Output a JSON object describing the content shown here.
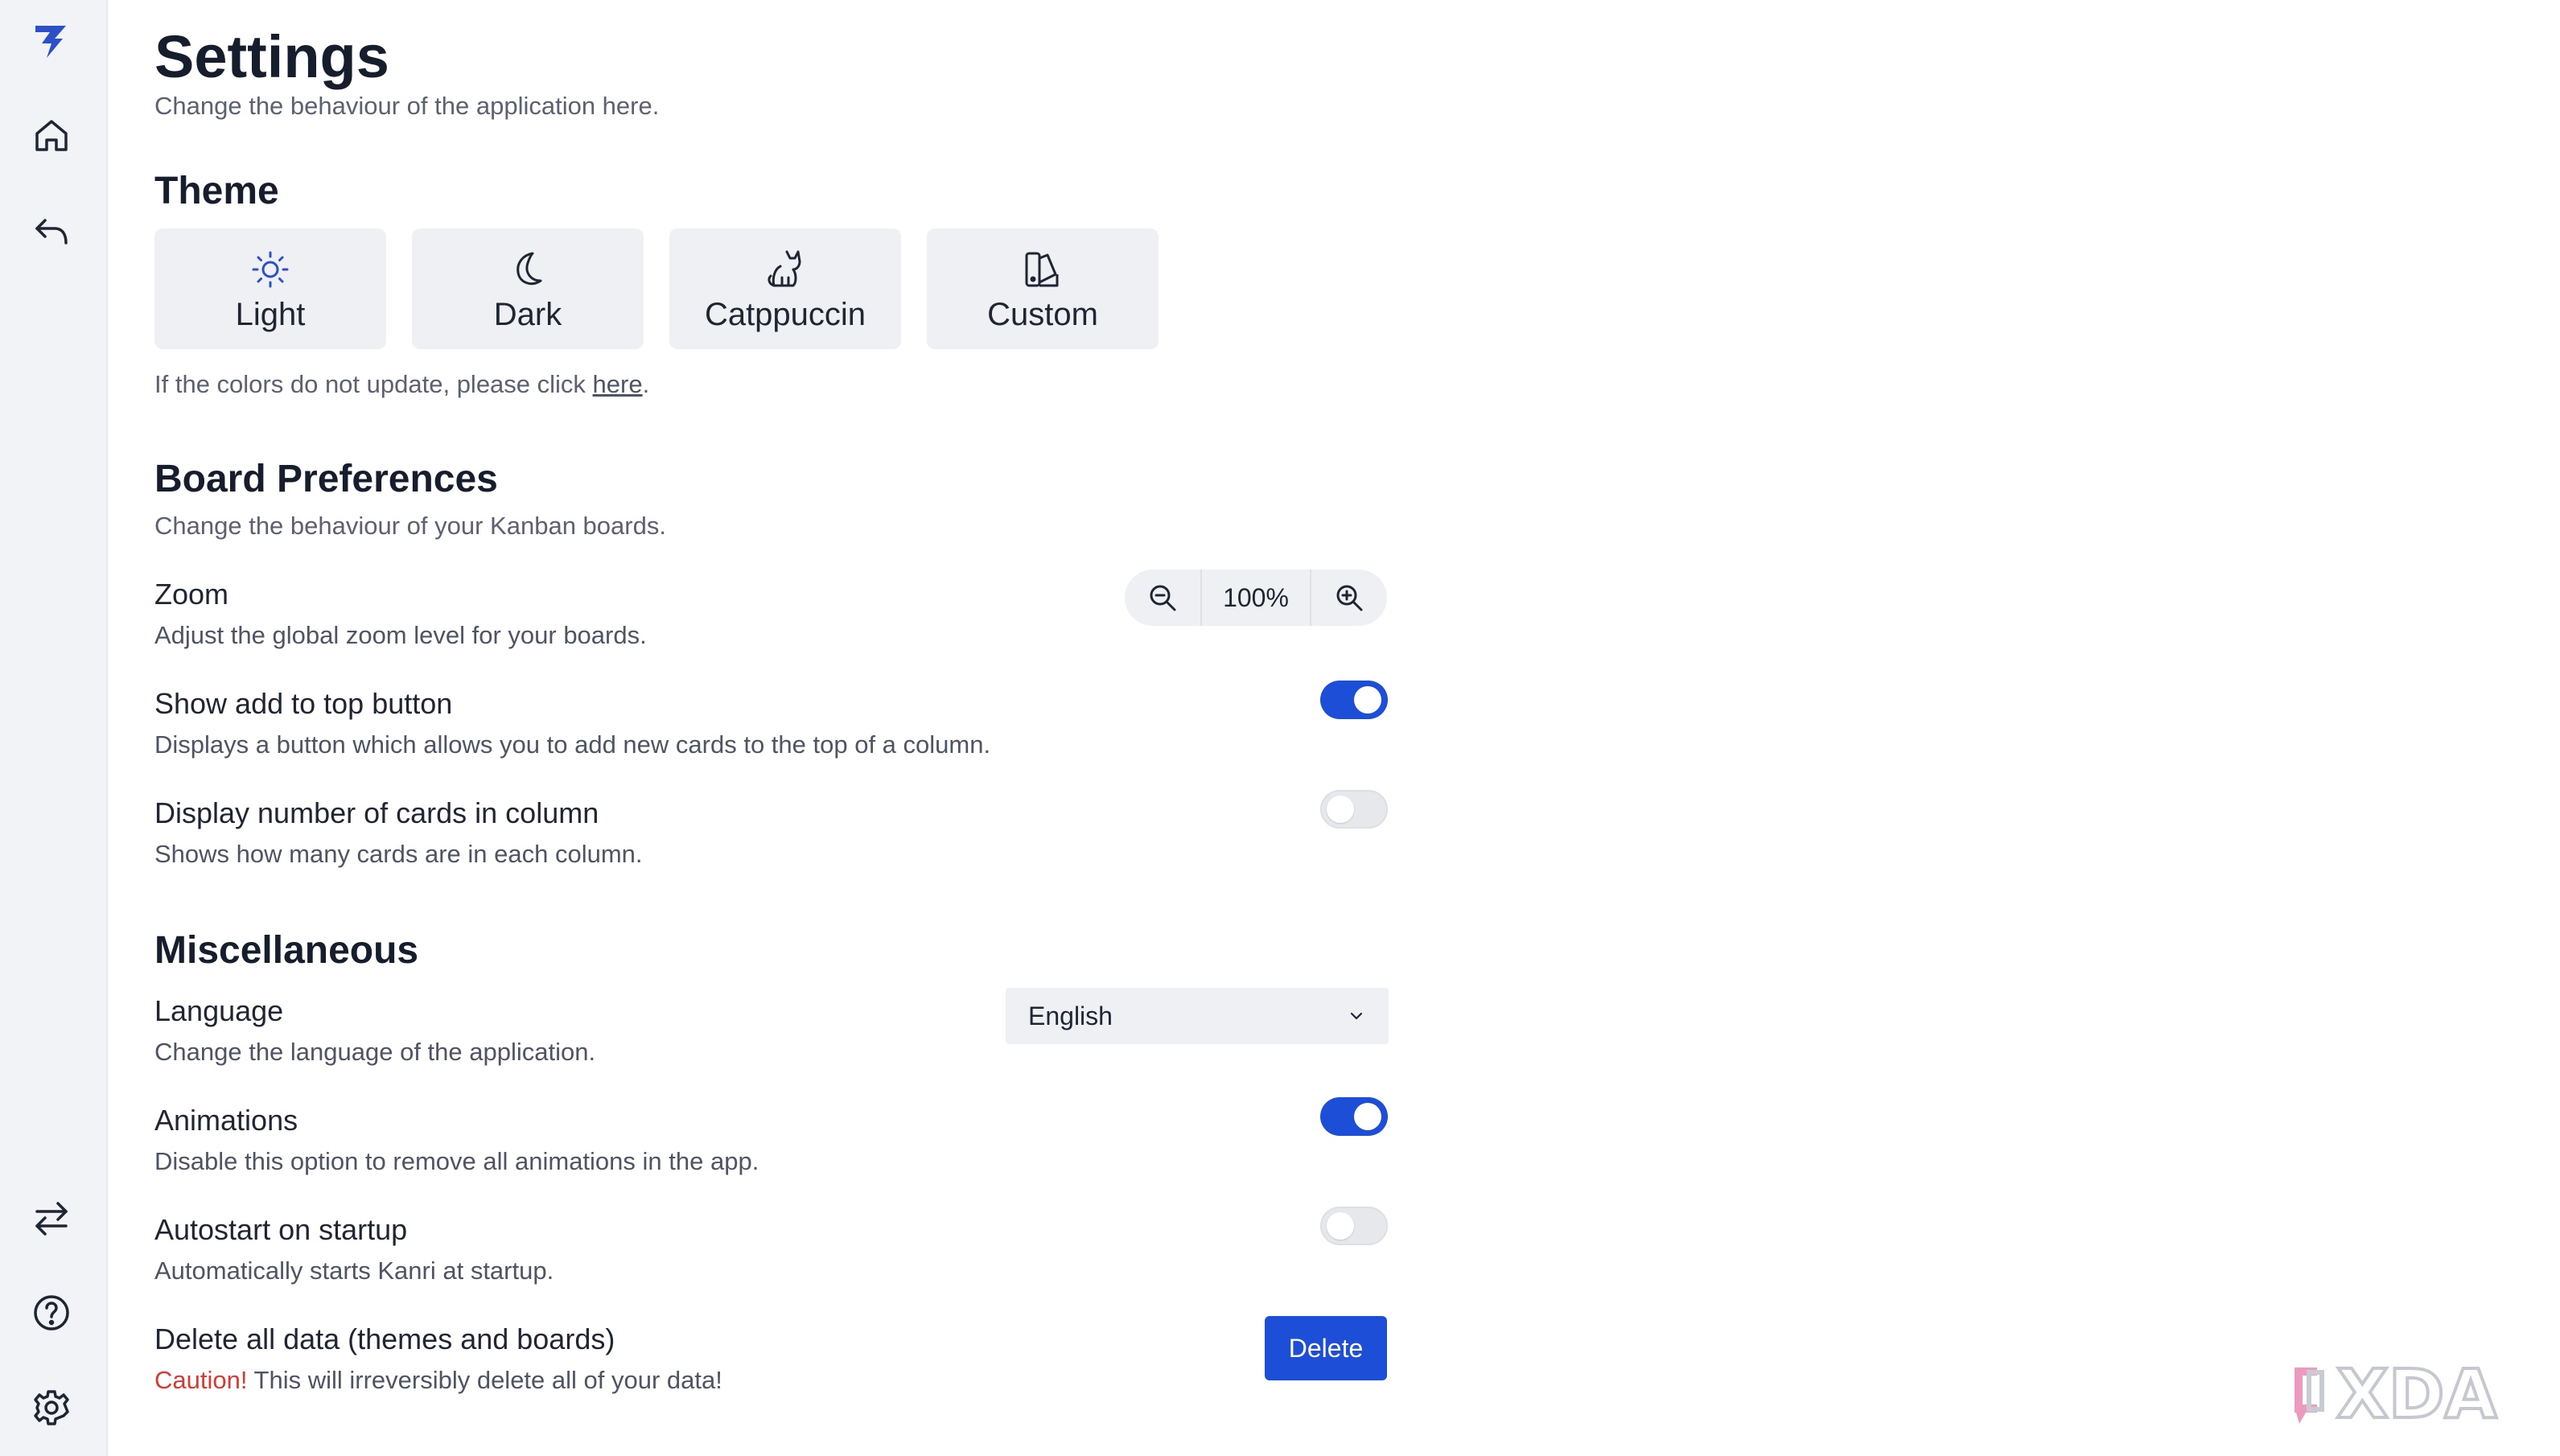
{
  "sidebar": {
    "icons": [
      "logo-icon",
      "home-icon",
      "back-icon",
      "swap-icon",
      "help-icon",
      "settings-icon"
    ]
  },
  "header": {
    "title": "Settings",
    "subtitle": "Change the behaviour of the application here."
  },
  "theme": {
    "title": "Theme",
    "options": [
      {
        "label": "Light",
        "icon": "sun-icon",
        "active": true
      },
      {
        "label": "Dark",
        "icon": "moon-icon"
      },
      {
        "label": "Catppuccin",
        "icon": "cat-icon"
      },
      {
        "label": "Custom",
        "icon": "palette-icon"
      }
    ],
    "note_prefix": "If the colors do not update, please click ",
    "note_link": "here",
    "note_suffix": "."
  },
  "board": {
    "title": "Board Preferences",
    "subtitle": "Change the behaviour of your Kanban boards.",
    "zoom": {
      "label": "Zoom",
      "desc": "Adjust the global zoom level for your boards.",
      "value": "100%"
    },
    "add_top": {
      "label": "Show add to top button",
      "desc": "Displays a button which allows you to add new cards to the top of a column.",
      "on": true
    },
    "card_count": {
      "label": "Display number of cards in column",
      "desc": "Shows how many cards are in each column.",
      "on": false
    }
  },
  "misc": {
    "title": "Miscellaneous",
    "language": {
      "label": "Language",
      "desc": "Change the language of the application.",
      "value": "English"
    },
    "animations": {
      "label": "Animations",
      "desc": "Disable this option to remove all animations in the app.",
      "on": true
    },
    "autostart": {
      "label": "Autostart on startup",
      "desc": "Automatically starts Kanri at startup.",
      "on": false
    },
    "delete": {
      "label": "Delete all data (themes and boards)",
      "caution": "Caution!",
      "desc": " This will irreversibly delete all of your data!",
      "button": "Delete"
    }
  },
  "watermark": {
    "text": "XDA"
  },
  "colors": {
    "accent": "#1d4ed8",
    "caution": "#d63a33",
    "sidebar_bg": "#f1f3f6",
    "button_bg": "#eef0f3"
  }
}
